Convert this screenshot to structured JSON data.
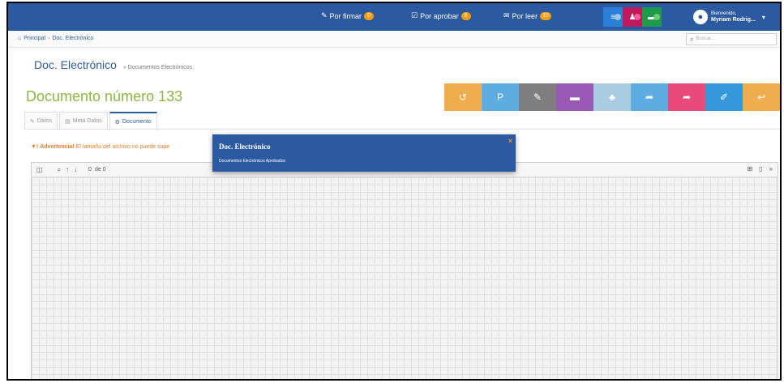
{
  "navbar": {
    "por_firmar": {
      "label": "Por firmar",
      "count": "0"
    },
    "por_aprobar": {
      "label": "Por aprobar",
      "count": "0"
    },
    "por_leer": {
      "label": "Por leer",
      "count": "10"
    },
    "user": {
      "greeting": "Bienvenido,",
      "name": "Myriam Rodrig..."
    }
  },
  "breadcrumb": {
    "home": "Principal",
    "current": "Doc. Electrónico"
  },
  "search": {
    "placeholder": "Buscar..."
  },
  "section": {
    "title": "Doc. Electrónico",
    "subtitle": "» Documentos Electrónicos"
  },
  "document": {
    "title": "Documento número 133"
  },
  "actions": [
    {
      "icon": "undo-icon",
      "color": "#f0ad4e"
    },
    {
      "icon": "p-icon",
      "color": "#5dade2",
      "label": "P"
    },
    {
      "icon": "paperclip-icon",
      "color": "#7f7f7f"
    },
    {
      "icon": "comment-icon",
      "color": "#9b59b6"
    },
    {
      "icon": "users-icon",
      "color": "#a9cce3"
    },
    {
      "icon": "share-icon",
      "color": "#5dade2"
    },
    {
      "icon": "forward-icon",
      "color": "#e84a7b"
    },
    {
      "icon": "edit-icon",
      "color": "#3498db"
    },
    {
      "icon": "reply-icon",
      "color": "#f0ad4e"
    }
  ],
  "tabs": [
    {
      "label": "Datos",
      "active": false
    },
    {
      "label": "Meta Datos",
      "active": false
    },
    {
      "label": "Documento",
      "active": true
    }
  ],
  "warning": {
    "prefix": "Advertencia!",
    "text": "El tamaño del archivo no puede supe"
  },
  "viewer": {
    "page": "0",
    "of": "de 0"
  },
  "popup": {
    "title": "Doc. Electrónico",
    "message": "Documentos Electrónicos Aprobados",
    "close": "×"
  },
  "colors": {
    "primary": "#2c5aa0",
    "doc_title": "#8ab83d",
    "warning": "#e67e22",
    "badge": "#f39c12"
  }
}
